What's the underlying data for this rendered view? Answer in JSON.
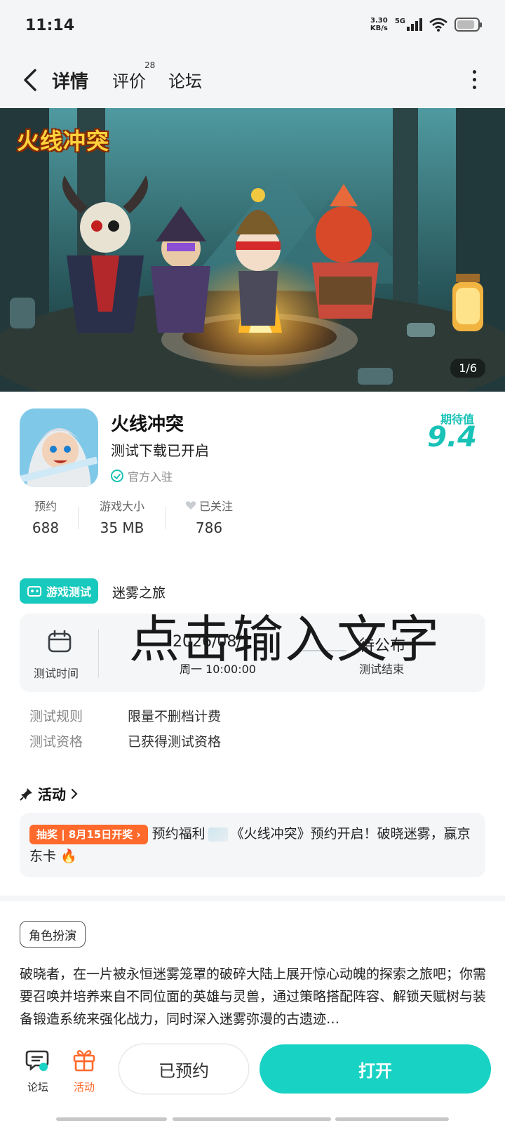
{
  "status_bar": {
    "time": "11:14",
    "speed_value": "3.30",
    "speed_unit": "KB/s",
    "network": "5G",
    "battery_level": 0.85
  },
  "nav": {
    "tabs": [
      {
        "label": "详情",
        "active": true
      },
      {
        "label": "评价",
        "badge": "28"
      },
      {
        "label": "论坛"
      }
    ],
    "back_icon": "chevron-left-icon",
    "more_icon": "more-vertical-icon"
  },
  "banner": {
    "logo_text": "火线冲突",
    "page_indicator": "1/6"
  },
  "game": {
    "name": "火线冲突",
    "status": "测试下载已开启",
    "official": "官方入驻",
    "expect_label": "期待值",
    "expect_value": "9.4",
    "stats": [
      {
        "label": "预约",
        "value": "688"
      },
      {
        "label": "游戏大小",
        "value": "35 MB"
      },
      {
        "label": "已关注",
        "value": "786"
      }
    ]
  },
  "test": {
    "tag": "游戏测试",
    "name": "迷雾之旅",
    "time_label": "测试时间",
    "start_date": "2026/08/1",
    "start_time": "周一  10:00:00",
    "end_date": "待公布",
    "end_label": "测试结束",
    "overlay_text": "点击输入文字",
    "rules": [
      {
        "label": "测试规则",
        "value": "限量不删档计费"
      },
      {
        "label": "测试资格",
        "value": "已获得测试资格"
      }
    ]
  },
  "activity": {
    "header": "活动",
    "badge": "抽奖 | 8月15日开奖 ›",
    "text_prefix": "预约福利",
    "text_main": "《火线冲突》预约开启！破晓迷雾，赢京东卡",
    "fire": "🔥"
  },
  "description": {
    "genre": "角色扮演",
    "text": "破晓者，在一片被永恒迷雾笼罩的破碎大陆上展开惊心动魄的探索之旅吧；你需要召唤并培养来自不同位面的英雄与灵兽，通过策略搭配阵容、解锁天赋树与装备锻造系统来强化战力，同时深入迷雾弥漫的古遗迹…"
  },
  "bottom_bar": {
    "forum_label": "论坛",
    "activity_label": "活动",
    "reserved_label": "已预约",
    "open_label": "打开"
  },
  "colors": {
    "accent": "#18d2c4",
    "orange": "#ff6a2c",
    "bg_gray": "#f4f5f7"
  }
}
